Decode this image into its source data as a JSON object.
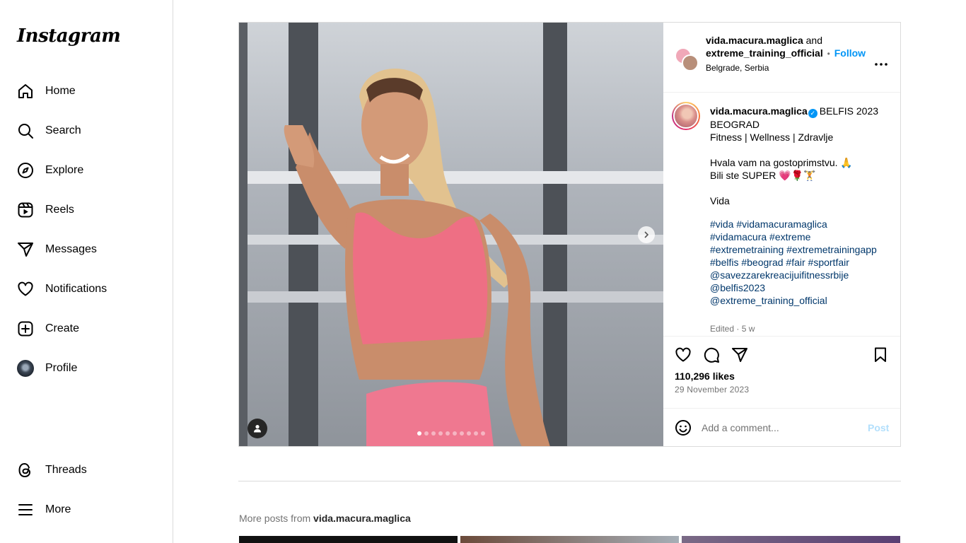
{
  "sidebar": {
    "logo": "Instagram",
    "items": [
      {
        "label": "Home",
        "icon": "home-icon"
      },
      {
        "label": "Search",
        "icon": "search-icon"
      },
      {
        "label": "Explore",
        "icon": "compass-icon"
      },
      {
        "label": "Reels",
        "icon": "reels-icon"
      },
      {
        "label": "Messages",
        "icon": "paper-plane-icon"
      },
      {
        "label": "Notifications",
        "icon": "heart-icon"
      },
      {
        "label": "Create",
        "icon": "plus-square-icon"
      },
      {
        "label": "Profile",
        "icon": "profile-avatar"
      }
    ],
    "bottom": [
      {
        "label": "Threads",
        "icon": "threads-icon"
      },
      {
        "label": "More",
        "icon": "hamburger-icon"
      }
    ]
  },
  "post": {
    "header": {
      "user1": "vida.macura.maglica",
      "joiner": "and",
      "user2": "extreme_training_official",
      "separator": "•",
      "follow": "Follow",
      "location": "Belgrade, Serbia"
    },
    "caption": {
      "username": "vida.macura.maglica",
      "text": "BELFIS 2023 BEOGRAD\nFitness | Wellness | Zdravlje\n\nHvala vam na gostoprimstvu. 🙏\nBili ste SUPER 💗🌹🏋\n\nVida",
      "hashtags": "#vida #vidamacuramaglica #vidamacura #extreme #extremetraining #extremetrainingapp #belfis #beograd #fair #sportfair @savezzarekreacijuifitnessrbije @belfis2023 @extreme_training_official",
      "edited": "Edited · 5 w"
    },
    "likes": "110,296 likes",
    "date": "29 November 2023",
    "comment_placeholder": "Add a comment...",
    "post_button": "Post",
    "carousel": {
      "count": 10,
      "active": 0
    }
  },
  "more_posts": {
    "prefix": "More posts from",
    "username": "vida.macura.maglica"
  },
  "colors": {
    "accent": "#0095f6",
    "hashtag": "#00376b",
    "muted": "#737373",
    "post_disabled": "#b2dffc",
    "top_pink": "#ee6f84"
  }
}
